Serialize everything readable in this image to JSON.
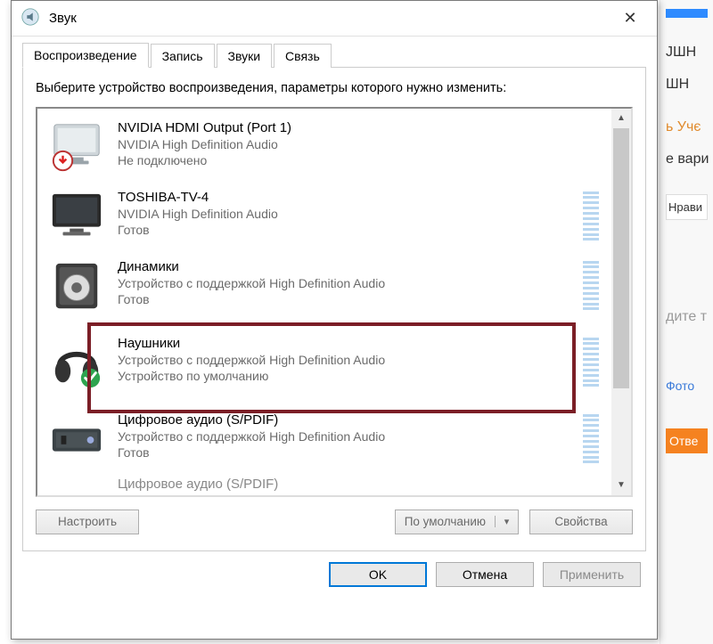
{
  "window": {
    "title": "Звук",
    "close_label": "✕"
  },
  "tabs": [
    {
      "label": "Воспроизведение",
      "active": true
    },
    {
      "label": "Запись",
      "active": false
    },
    {
      "label": "Звуки",
      "active": false
    },
    {
      "label": "Связь",
      "active": false
    }
  ],
  "instruction": "Выберите устройство воспроизведения, параметры которого нужно изменить:",
  "devices": [
    {
      "title": "NVIDIA HDMI Output (Port 1)",
      "subtitle": "NVIDIA High Definition Audio",
      "status": "Не подключено",
      "icon": "monitor-disconnected",
      "meter": false
    },
    {
      "title": "TOSHIBA-TV-4",
      "subtitle": "NVIDIA High Definition Audio",
      "status": "Готов",
      "icon": "monitor",
      "meter": true
    },
    {
      "title": "Динамики",
      "subtitle": "Устройство с поддержкой High Definition Audio",
      "status": "Готов",
      "icon": "speaker",
      "meter": true
    },
    {
      "title": "Наушники",
      "subtitle": "Устройство с поддержкой High Definition Audio",
      "status": "Устройство по умолчанию",
      "icon": "headphones-default",
      "meter": true,
      "highlighted": true
    },
    {
      "title": "Цифровое аудио (S/PDIF)",
      "subtitle": "Устройство с поддержкой High Definition Audio",
      "status": "Готов",
      "icon": "spdif",
      "meter": true
    },
    {
      "title": "Цифровое аудио (S/PDIF)",
      "subtitle": "",
      "status": "",
      "icon": "spdif",
      "meter": false,
      "partial": true
    }
  ],
  "inner_buttons": {
    "configure": "Настроить",
    "set_default": "По умолчанию",
    "properties": "Свойства"
  },
  "footer": {
    "ok": "OK",
    "cancel": "Отмена",
    "apply": "Применить"
  },
  "background_hints": {
    "line1": "ЈШН",
    "line2": "ШН",
    "line3": "ь Учє",
    "line4": "е вари",
    "line5": "Нрави",
    "line6": "дите т",
    "link": "Фото",
    "button": "Отве"
  }
}
